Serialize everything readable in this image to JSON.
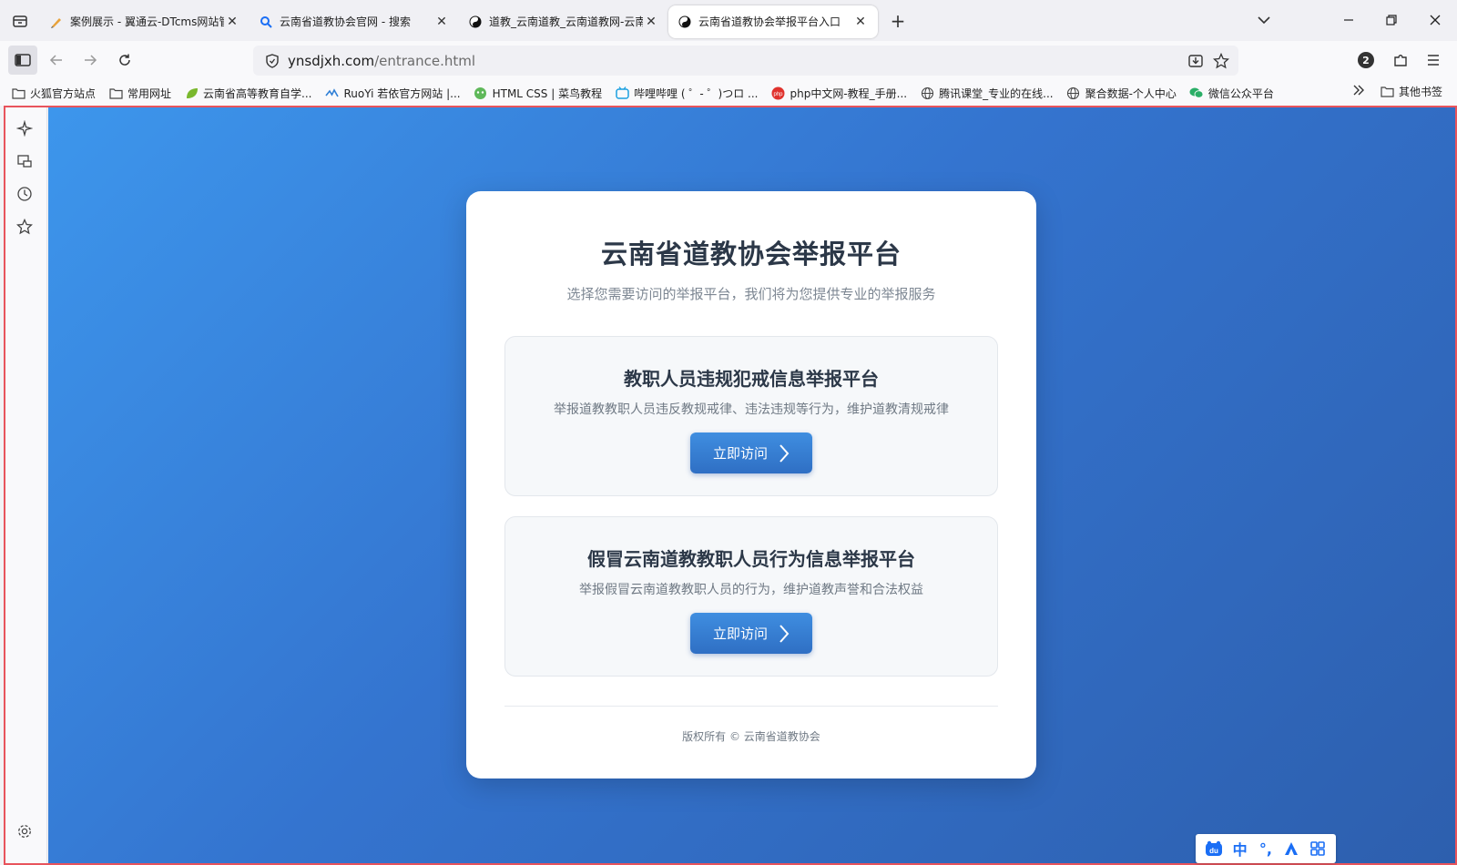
{
  "browser": {
    "tabs": [
      {
        "title": "案例展示 - 翼通云-DTcms网站管",
        "favicon": "pen-icon",
        "active": false
      },
      {
        "title": "云南省道教协会官网 - 搜索",
        "favicon": "search-icon",
        "active": false
      },
      {
        "title": "道教_云南道教_云南道教网-云南",
        "favicon": "yinyang-icon",
        "active": false
      },
      {
        "title": "云南省道教协会举报平台入口",
        "favicon": "yinyang-icon",
        "active": true
      }
    ],
    "close_glyph": "✕",
    "new_tab_glyph": "+",
    "url_host": "ynsdjxh.com",
    "url_path": "/entrance.html",
    "notification_count": "2",
    "bookmarks": [
      {
        "label": "火狐官方站点",
        "icon": "folder-icon"
      },
      {
        "label": "常用网址",
        "icon": "folder-icon"
      },
      {
        "label": "云南省高等教育自学...",
        "icon": "leaf-icon"
      },
      {
        "label": "RuoYi 若依官方网站 |...",
        "icon": "ruoyi-icon"
      },
      {
        "label": "HTML CSS | 菜鸟教程",
        "icon": "runoob-icon"
      },
      {
        "label": "哔哩哔哩 ( ゜- ゜)つロ ...",
        "icon": "bilibili-icon"
      },
      {
        "label": "php中文网-教程_手册...",
        "icon": "php-icon"
      },
      {
        "label": "腾讯课堂_专业的在线...",
        "icon": "globe-icon"
      },
      {
        "label": "聚合数据-个人中心",
        "icon": "globe-icon"
      },
      {
        "label": "微信公众平台",
        "icon": "wechat-icon"
      }
    ],
    "other_bookmarks": "其他书签"
  },
  "page": {
    "title": "云南省道教协会举报平台",
    "subtitle": "选择您需要访问的举报平台，我们将为您提供专业的举报服务",
    "platforms": [
      {
        "title": "教职人员违规犯戒信息举报平台",
        "description": "举报道教教职人员违反教规戒律、违法违规等行为，维护道教清规戒律",
        "button_label": "立即访问"
      },
      {
        "title": "假冒云南道教教职人员行为信息举报平台",
        "description": "举报假冒云南道教教职人员的行为，维护道教声誉和合法权益",
        "button_label": "立即访问"
      }
    ],
    "copyright": "版权所有 © 云南省道教协会"
  },
  "ime": {
    "mode_label": "中",
    "punct_label": "°,"
  },
  "colors": {
    "accent": "#3474cf",
    "frame_border": "#e8545c",
    "card_title": "#2c3848"
  }
}
